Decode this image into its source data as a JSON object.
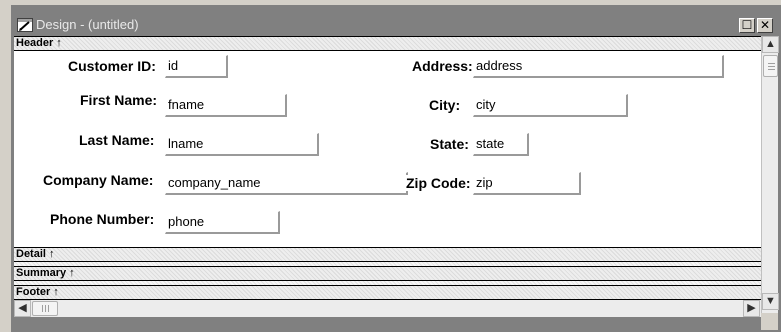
{
  "window": {
    "title": "Design - (untitled)",
    "restore_glyph": "☐",
    "close_glyph": "✕"
  },
  "bands": {
    "header": "Header",
    "detail": "Detail",
    "summary": "Summary",
    "footer": "Footer",
    "arrow": "↑"
  },
  "fields": {
    "customer_id": {
      "label": "Customer ID:",
      "value": "id"
    },
    "first_name": {
      "label": "First Name:",
      "value": "fname"
    },
    "last_name": {
      "label": "Last Name:",
      "value": "lname"
    },
    "company_name": {
      "label": "Company Name:",
      "value": "company_name"
    },
    "phone_number": {
      "label": "Phone Number:",
      "value": "phone"
    },
    "address": {
      "label": "Address:",
      "value": "address"
    },
    "city": {
      "label": "City:",
      "value": "city"
    },
    "state": {
      "label": "State:",
      "value": "state"
    },
    "zip_code": {
      "label": "Zip Code:",
      "value": "zip"
    }
  },
  "scrollbars": {
    "up": "▲",
    "down": "▼",
    "left": "◀",
    "right": "▶"
  },
  "icons": {
    "window_icon": "pencil-window-icon"
  }
}
